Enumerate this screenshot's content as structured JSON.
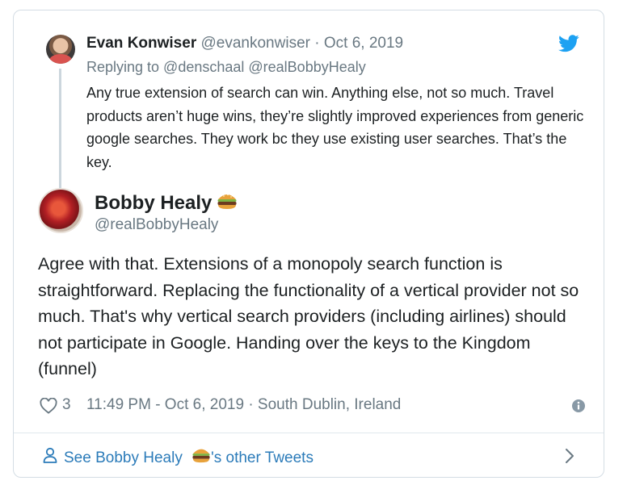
{
  "parent_tweet": {
    "author_name": "Evan Konwiser",
    "author_handle": "@evankonwiser",
    "separator": "·",
    "date": "Oct 6, 2019",
    "reply_line": "Replying to @denschaal @realBobbyHealy",
    "text": "Any true extension of search can win. Anything else, not so much. Travel products aren’t huge wins, they’re slightly improved experiences from generic google searches. They work bc they use existing user searches. That’s the key."
  },
  "main_tweet": {
    "author_name": "Bobby Healy",
    "author_handle": "@realBobbyHealy",
    "text": "Agree with that. Extensions of a monopoly search function is straightforward. Replacing the functionality of a vertical provider not so much. That's why vertical search providers (including airlines) should not participate in Google. Handing over the keys to the Kingdom (funnel)",
    "like_count": "3",
    "timestamp": "11:49 PM - Oct 6, 2019",
    "separator": "·",
    "location": "South Dublin, Ireland"
  },
  "more_tweets": {
    "prefix": "See Bobby Healy",
    "suffix": "'s other Tweets"
  },
  "icons": {
    "brand": "twitter-bird-icon",
    "like": "heart-icon",
    "info": "info-icon",
    "profile": "person-icon",
    "chevron": "chevron-right-icon",
    "emoji": "hamburger-emoji"
  },
  "colors": {
    "twitter_blue": "#1da1f2",
    "link_blue": "#2b7bb9",
    "muted_text": "#697882",
    "border": "#d4dde4"
  }
}
